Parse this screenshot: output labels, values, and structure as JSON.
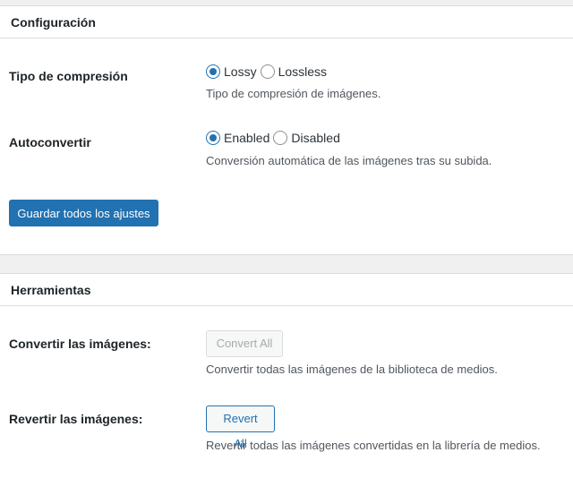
{
  "config": {
    "title": "Configuración",
    "compression": {
      "label": "Tipo de compresión",
      "options": [
        {
          "label": "Lossy",
          "checked": true
        },
        {
          "label": "Lossless",
          "checked": false
        }
      ],
      "description": "Tipo de compresión de imágenes."
    },
    "autoconvert": {
      "label": "Autoconvertir",
      "options": [
        {
          "label": "Enabled",
          "checked": true
        },
        {
          "label": "Disabled",
          "checked": false
        }
      ],
      "description": "Conversión automática de las imágenes tras su subida."
    },
    "save_label": "Guardar todos los ajustes"
  },
  "tools": {
    "title": "Herramientas",
    "convert": {
      "label": "Convertir las imágenes:",
      "button": "Convert All",
      "button_disabled": true,
      "description": "Convertir todas las imágenes de la biblioteca de medios."
    },
    "revert": {
      "label": "Revertir las imágenes:",
      "button": "Revert All",
      "description": "Revertir todas las imágenes convertidas en la librería de medios."
    }
  },
  "colors": {
    "accent": "#2271b1",
    "background": "#f0f0f1",
    "border": "#dcdcde"
  }
}
